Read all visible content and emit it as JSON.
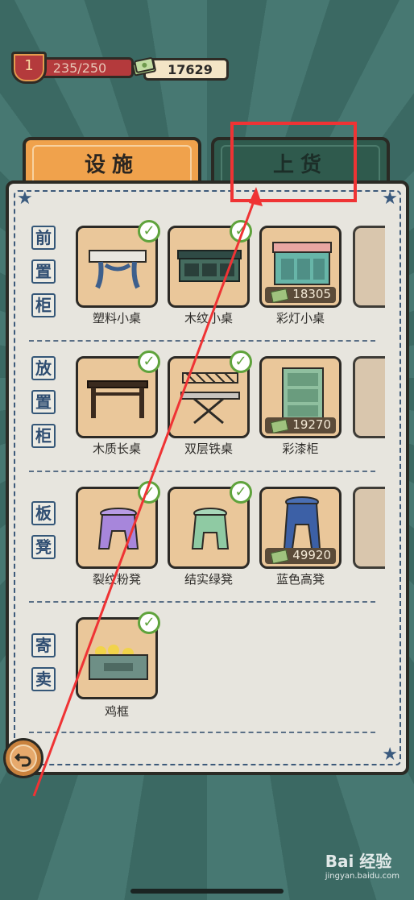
{
  "status": {
    "level": "1",
    "xp": "235/250",
    "money": "17629"
  },
  "tabs": {
    "facility": "设施",
    "stock": "上货"
  },
  "categories": [
    {
      "chars": [
        "前",
        "置",
        "柜"
      ]
    },
    {
      "chars": [
        "放",
        "置",
        "柜"
      ]
    },
    {
      "chars": [
        "板",
        "凳"
      ]
    },
    {
      "chars": [
        "寄",
        "卖"
      ]
    }
  ],
  "items": {
    "row1": [
      {
        "name": "塑料小桌",
        "owned": true
      },
      {
        "name": "木纹小桌",
        "owned": true
      },
      {
        "name": "彩灯小桌",
        "price": "18305"
      }
    ],
    "row2": [
      {
        "name": "木质长桌",
        "owned": true
      },
      {
        "name": "双层铁桌",
        "owned": true
      },
      {
        "name": "彩漆柜",
        "price": "19270"
      }
    ],
    "row3": [
      {
        "name": "裂纹粉凳",
        "owned": true
      },
      {
        "name": "结实绿凳",
        "owned": true
      },
      {
        "name": "蓝色高凳",
        "price": "49920"
      }
    ],
    "row4": [
      {
        "name": "鸡框",
        "owned": true
      }
    ]
  },
  "icons": {
    "check": "check-icon",
    "cash": "cash-icon",
    "back": "back-arrow-icon",
    "star": "star-icon"
  },
  "watermark": {
    "brand": "Bai 经验",
    "site": "jingyan.baidu.com"
  },
  "colors": {
    "highlight": "#ef3334",
    "facility_tab": "#f0a24c",
    "stock_tab": "#2f5a4d"
  }
}
